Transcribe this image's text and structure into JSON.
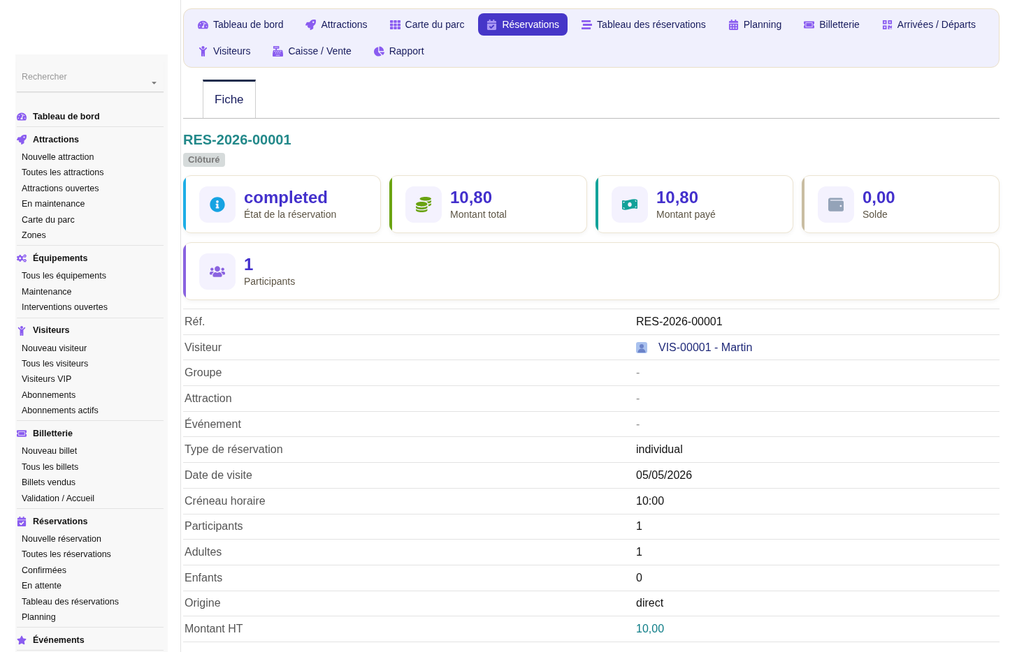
{
  "nav": {
    "tabs": [
      {
        "label": "Tableau de bord",
        "selected": false
      },
      {
        "label": "Attractions",
        "selected": false
      },
      {
        "label": "Carte du parc",
        "selected": false
      },
      {
        "label": "Réservations",
        "selected": true
      },
      {
        "label": "Tableau des réservations",
        "selected": false
      },
      {
        "label": "Planning",
        "selected": false
      },
      {
        "label": "Billetterie",
        "selected": false
      },
      {
        "label": "Arrivées / Départs",
        "selected": false
      },
      {
        "label": "Visiteurs",
        "selected": false
      },
      {
        "label": "Caisse / Vente",
        "selected": false
      },
      {
        "label": "Rapport",
        "selected": false
      }
    ]
  },
  "sidebar": {
    "search": {
      "placeholder": "Rechercher"
    },
    "sections": [
      {
        "title": "Tableau de bord"
      },
      {
        "title": "Attractions",
        "items": [
          "Nouvelle attraction",
          "Toutes les attractions",
          "Attractions ouvertes",
          "En maintenance",
          "Carte du parc",
          "Zones"
        ]
      },
      {
        "title": "Équipements",
        "items": [
          "Tous les équipements",
          "Maintenance",
          "Interventions ouvertes"
        ]
      },
      {
        "title": "Visiteurs",
        "items": [
          "Nouveau visiteur",
          "Tous les visiteurs",
          "Visiteurs VIP",
          "Abonnements",
          "Abonnements actifs"
        ]
      },
      {
        "title": "Billetterie",
        "items": [
          "Nouveau billet",
          "Tous les billets",
          "Billets vendus",
          "Validation / Accueil"
        ]
      },
      {
        "title": "Réservations",
        "items": [
          "Nouvelle réservation",
          "Toutes les réservations",
          "Confirmées",
          "En attente",
          "Tableau des réservations",
          "Planning"
        ]
      },
      {
        "title": "Événements"
      }
    ]
  },
  "tabs": [
    {
      "label": "Fiche",
      "selected": true
    }
  ],
  "record": {
    "title": "RES-2026-00001",
    "status": "Clôturé"
  },
  "cards": [
    {
      "value": "completed",
      "label": "État de la réservation",
      "color": "#1eaee6"
    },
    {
      "value": "10,80",
      "label": "Montant total",
      "color": "#6ba412"
    },
    {
      "value": "10,80",
      "label": "Montant payé",
      "color": "#13a39a"
    },
    {
      "value": "0,00",
      "label": "Solde",
      "color": "#c9bda2"
    }
  ],
  "participants_card": {
    "value": "1",
    "label": "Participants",
    "color": "#8a63e0"
  },
  "details": [
    {
      "kind": "text",
      "label": "Réf.",
      "value": "RES-2026-00001"
    },
    {
      "kind": "link",
      "label": "Visiteur",
      "value": "VIS-00001 - Martin"
    },
    {
      "kind": "empty",
      "label": "Groupe",
      "value": "-"
    },
    {
      "kind": "empty",
      "label": "Attraction",
      "value": "-"
    },
    {
      "kind": "empty",
      "label": "Événement",
      "value": "-"
    },
    {
      "kind": "text",
      "label": "Type de réservation",
      "value": "individual"
    },
    {
      "kind": "text",
      "label": "Date de visite",
      "value": "05/05/2026"
    },
    {
      "kind": "text",
      "label": "Créneau horaire",
      "value": "10:00"
    },
    {
      "kind": "text",
      "label": "Participants",
      "value": "1"
    },
    {
      "kind": "text",
      "label": "Adultes",
      "value": "1"
    },
    {
      "kind": "text",
      "label": "Enfants",
      "value": "0"
    },
    {
      "kind": "text",
      "label": "Origine",
      "value": "direct"
    },
    {
      "kind": "amount",
      "label": "Montant HT",
      "value": "10,00"
    }
  ]
}
